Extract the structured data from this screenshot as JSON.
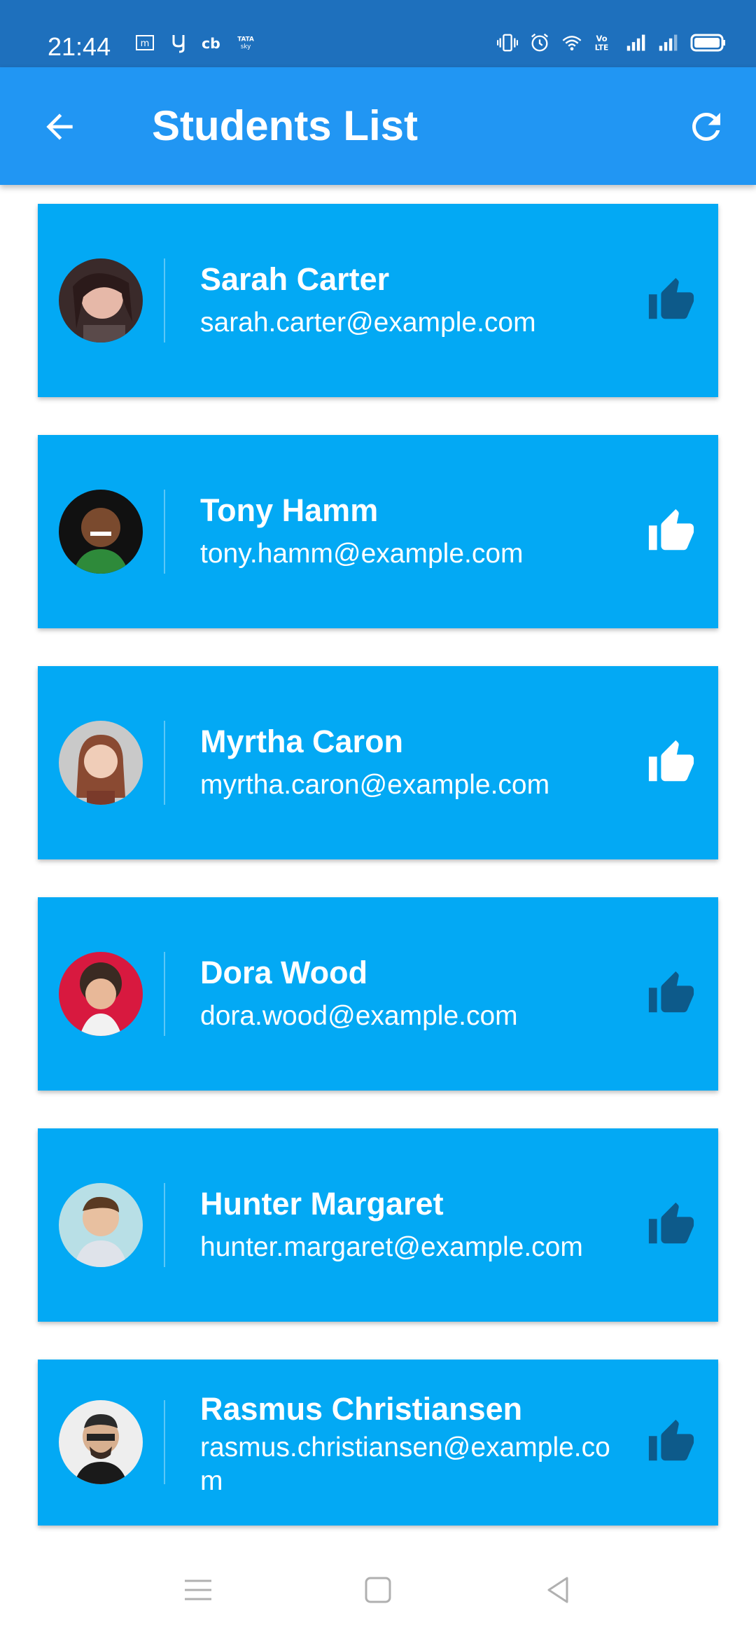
{
  "status_bar": {
    "time": "21:44",
    "left_icons": [
      "m-app-icon",
      "y-app-icon",
      "cb-app-icon",
      "tata-sky-icon"
    ],
    "right_icons": [
      "vibrate-icon",
      "alarm-icon",
      "wifi-icon",
      "volte-icon",
      "signal-icon",
      "signal-icon",
      "battery-icon"
    ],
    "volte_label": "Vo LTE"
  },
  "app_bar": {
    "title": "Students List",
    "back_icon": "arrow-back-icon",
    "refresh_icon": "refresh-icon",
    "color": "#2196f3"
  },
  "students": [
    {
      "name": "Sarah Carter",
      "email": "sarah.carter@example.com",
      "liked": true,
      "like_color": "#0d5a8a"
    },
    {
      "name": "Tony Hamm",
      "email": "tony.hamm@example.com",
      "liked": false,
      "like_color": "#ffffff"
    },
    {
      "name": "Myrtha Caron",
      "email": "myrtha.caron@example.com",
      "liked": false,
      "like_color": "#ffffff"
    },
    {
      "name": "Dora Wood",
      "email": "dora.wood@example.com",
      "liked": true,
      "like_color": "#0d5a8a"
    },
    {
      "name": "Hunter Margaret",
      "email": "hunter.margaret@example.com",
      "liked": true,
      "like_color": "#0d5a8a"
    },
    {
      "name": "Rasmus Christiansen",
      "email": "rasmus.christiansen@example.com",
      "liked": true,
      "like_color": "#0d5a8a"
    }
  ],
  "colors": {
    "status_bar": "#1e70bd",
    "card": "#03a9f4",
    "liked": "#0d5a8a",
    "unliked": "#ffffff"
  },
  "nav_bar": {
    "icons": [
      "menu-icon",
      "home-square-icon",
      "back-triangle-icon"
    ]
  }
}
